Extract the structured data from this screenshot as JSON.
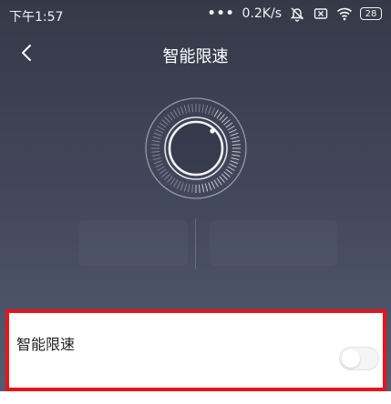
{
  "status_bar": {
    "time": "下午1:57",
    "dots": "•••",
    "speed": "0.2K/s",
    "battery": "28",
    "icons": [
      "mute-bell-icon",
      "sim-x-icon",
      "wifi-icon",
      "battery-icon"
    ]
  },
  "header": {
    "title": "智能限速",
    "back_icon": "chevron-left-icon"
  },
  "setting": {
    "label": "智能限速",
    "toggle_on": false
  },
  "colors": {
    "highlight_border": "#e8141b",
    "background_top": "#353a48",
    "background_bottom": "#565c71",
    "card": "#ffffff"
  }
}
